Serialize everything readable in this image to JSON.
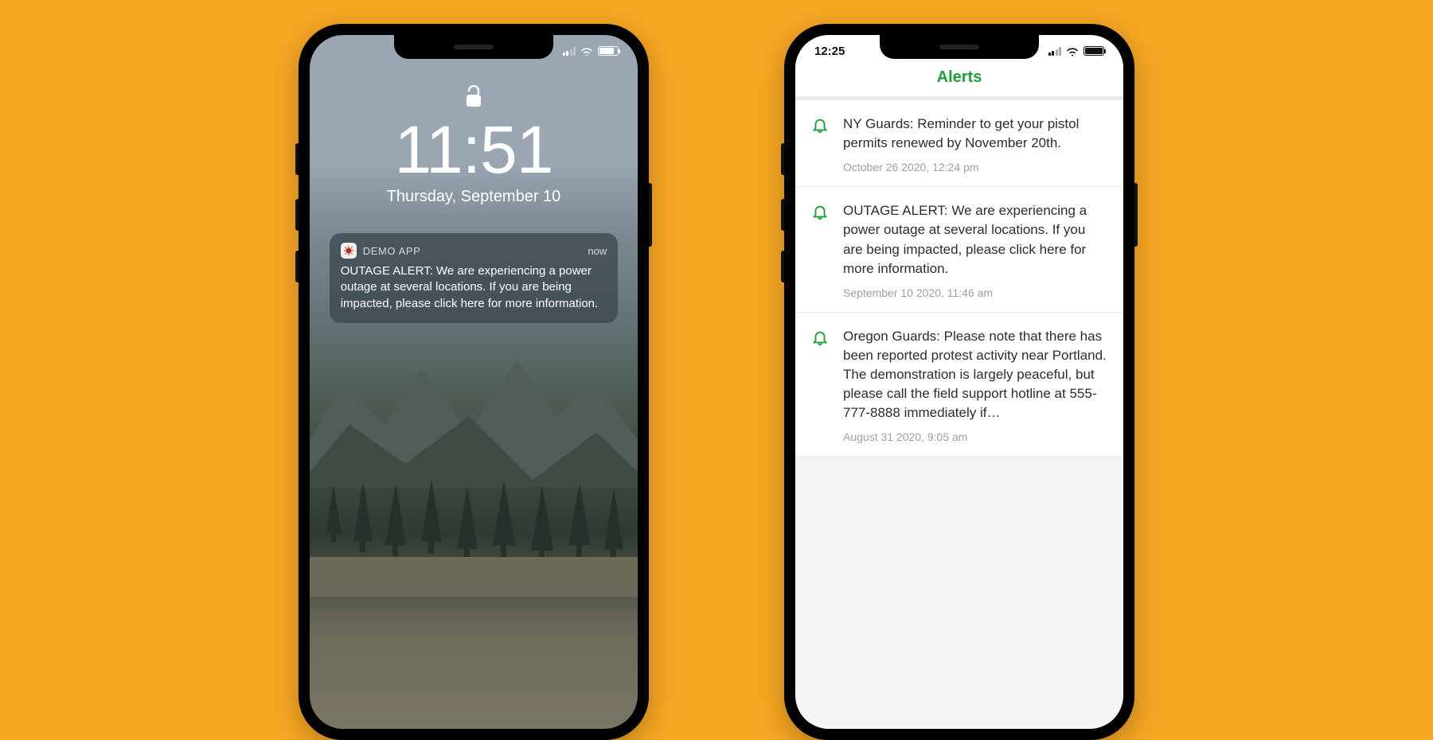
{
  "phone1": {
    "lock": {
      "time": "11:51",
      "date": "Thursday, September 10"
    },
    "notification": {
      "app_name": "DEMO APP",
      "time_label": "now",
      "body": "OUTAGE ALERT: We are experiencing a power outage at several locations. If you are being impacted, please click here for more information."
    }
  },
  "phone2": {
    "status_time": "12:25",
    "header_title": "Alerts",
    "alerts": [
      {
        "text": "NY Guards: Reminder to get your pistol permits renewed by November 20th.",
        "timestamp": "October 26 2020, 12:24 pm"
      },
      {
        "text": "OUTAGE ALERT: We are experiencing a power outage at several locations. If you are being impacted, please click here for more information.",
        "timestamp": "September 10 2020, 11:46 am"
      },
      {
        "text": "Oregon Guards: Please note that there has been reported protest activity near Portland. The demonstration is largely peaceful, but please call the field support hotline at 555-777-8888 immediately if…",
        "timestamp": "August 31 2020, 9:05 am"
      }
    ]
  }
}
